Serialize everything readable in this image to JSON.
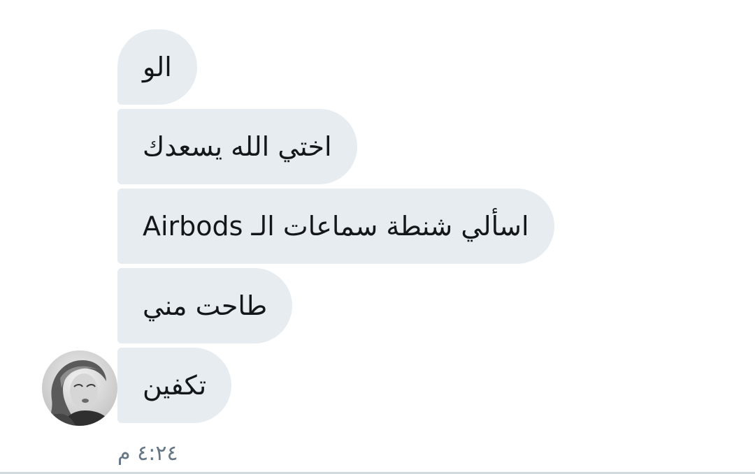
{
  "conversation": {
    "messages": [
      {
        "text": "الو"
      },
      {
        "text": "اختي الله يسعدك"
      },
      {
        "text": "اسألي شنطة سماعات الـ Airbods"
      },
      {
        "text": "طاحت مني"
      },
      {
        "text": "تكفين"
      }
    ],
    "timestamp": "٤:٢٤ م"
  },
  "sender": {
    "avatar_icon": "user-avatar"
  },
  "colors": {
    "bubble_background": "#e6ecf0",
    "text": "#14171a",
    "timestamp": "#657786"
  }
}
